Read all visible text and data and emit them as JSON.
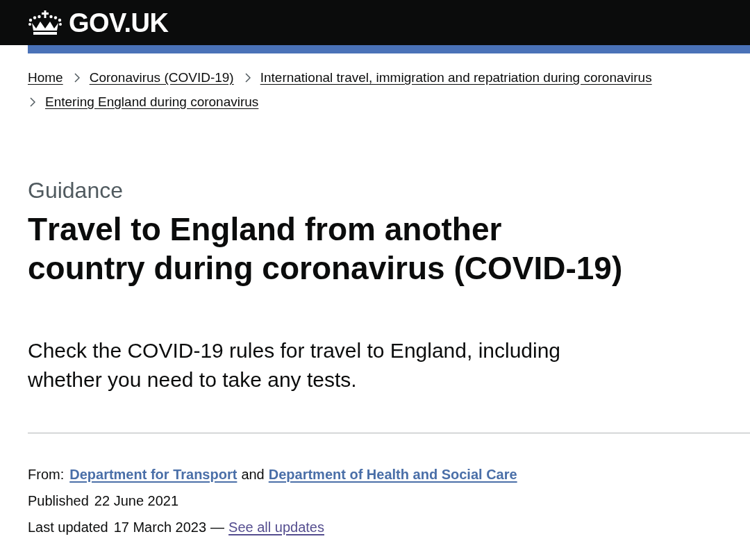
{
  "header": {
    "logo_text": "GOV.UK"
  },
  "breadcrumbs": [
    {
      "label": "Home"
    },
    {
      "label": "Coronavirus (COVID-19)"
    },
    {
      "label": "International travel, immigration and repatriation during coronavirus"
    },
    {
      "label": "Entering England during coronavirus"
    }
  ],
  "content_type": "Guidance",
  "title": "Travel to England from another country during coronavirus (COVID-19)",
  "summary": "Check the COVID-19 rules for travel to England, including whether you need to take any tests.",
  "metadata": {
    "from_label": "From:",
    "organisations": [
      "Department for Transport",
      "Department of Health and Social Care"
    ],
    "conjunction": "and",
    "published_label": "Published",
    "published_date": "22 June 2021",
    "updated_label": "Last updated",
    "updated_date": "17 March 2023",
    "separator": "—",
    "updates_link": "See all updates"
  }
}
